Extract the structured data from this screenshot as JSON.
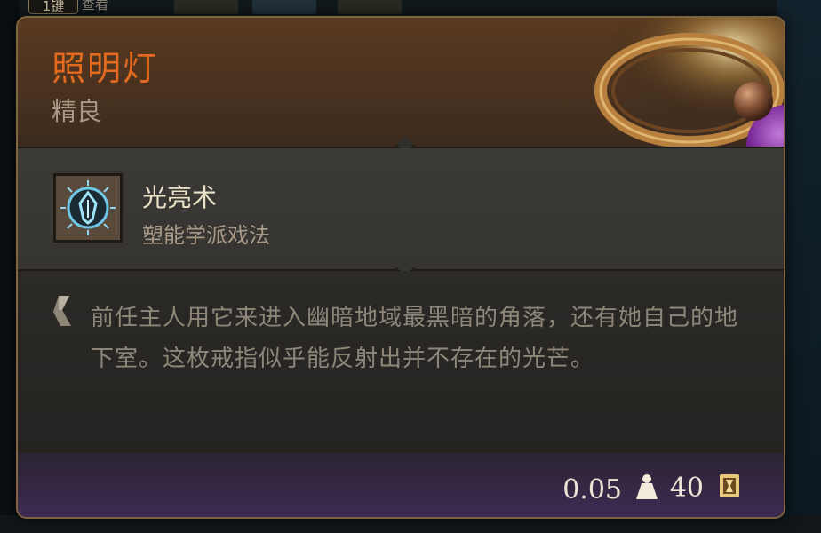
{
  "background": {
    "tab_label": "1键",
    "tab2_label": "查看"
  },
  "item": {
    "name": "照明灯",
    "rarity": "精良",
    "name_color": "#e36a1e",
    "spell": {
      "name": "光亮术",
      "school": "塑能学派戏法",
      "icon": "light-spell-icon"
    },
    "description": "前任主人用它来进入幽暗地域最黑暗的角落，还有她自己的地下室。这枚戒指似乎能反射出并不存在的光芒。",
    "weight": "0.05",
    "weight_icon": "weight-icon",
    "price": "40",
    "price_icon": "gold-coin-icon",
    "art_icon": "ring-icon"
  }
}
